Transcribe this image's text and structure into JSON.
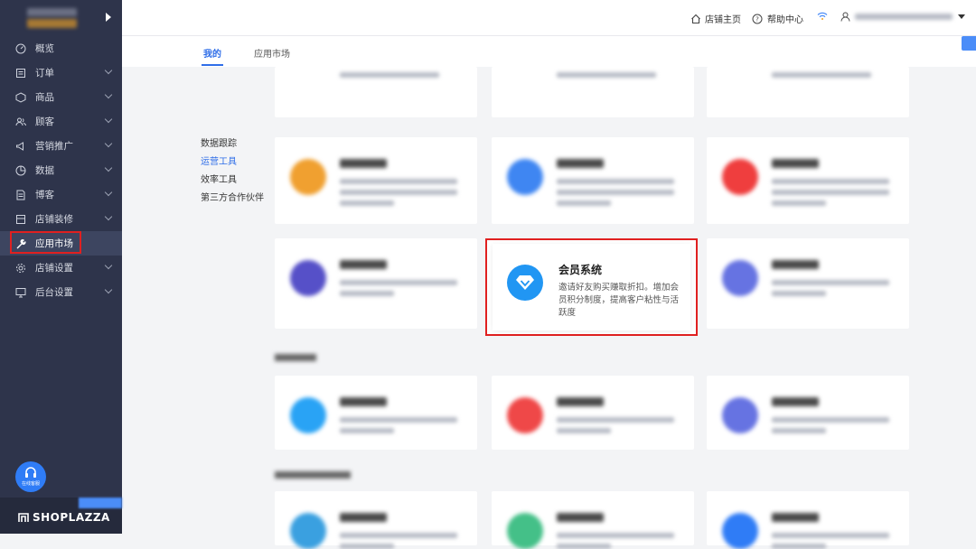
{
  "sidebar": {
    "items": [
      {
        "label": "概览",
        "icon": "dashboard-icon",
        "chevron": false
      },
      {
        "label": "订单",
        "icon": "order-icon",
        "chevron": true
      },
      {
        "label": "商品",
        "icon": "box-icon",
        "chevron": true
      },
      {
        "label": "顾客",
        "icon": "users-icon",
        "chevron": true
      },
      {
        "label": "营销推广",
        "icon": "megaphone-icon",
        "chevron": true
      },
      {
        "label": "数据",
        "icon": "chart-pie-icon",
        "chevron": true
      },
      {
        "label": "博客",
        "icon": "document-icon",
        "chevron": true
      },
      {
        "label": "店铺装修",
        "icon": "layout-icon",
        "chevron": true
      },
      {
        "label": "应用市场",
        "icon": "wrench-icon",
        "chevron": false
      },
      {
        "label": "店铺设置",
        "icon": "gear-icon",
        "chevron": true
      },
      {
        "label": "后台设置",
        "icon": "monitor-icon",
        "chevron": true
      }
    ],
    "active_index": 8,
    "support_label": "在线客服",
    "brand": "SHOPLAZZA"
  },
  "topbar": {
    "store_home": "店铺主页",
    "help_center": "帮助中心"
  },
  "tabs": [
    "我的",
    "应用市场"
  ],
  "categories": [
    "数据跟踪",
    "运营工具",
    "效率工具",
    "第三方合作伙伴"
  ],
  "active_category": 1,
  "featured_app": {
    "title": "会员系统",
    "description": "邀请好友购买赚取折扣。增加会员积分制度，提高客户粘性与活跃度",
    "icon": "diamond-icon",
    "icon_color": "#2196f3"
  },
  "colors": {
    "accent": "#2f6ee8",
    "highlight": "#e02020",
    "sidebar": "#2e344b"
  }
}
